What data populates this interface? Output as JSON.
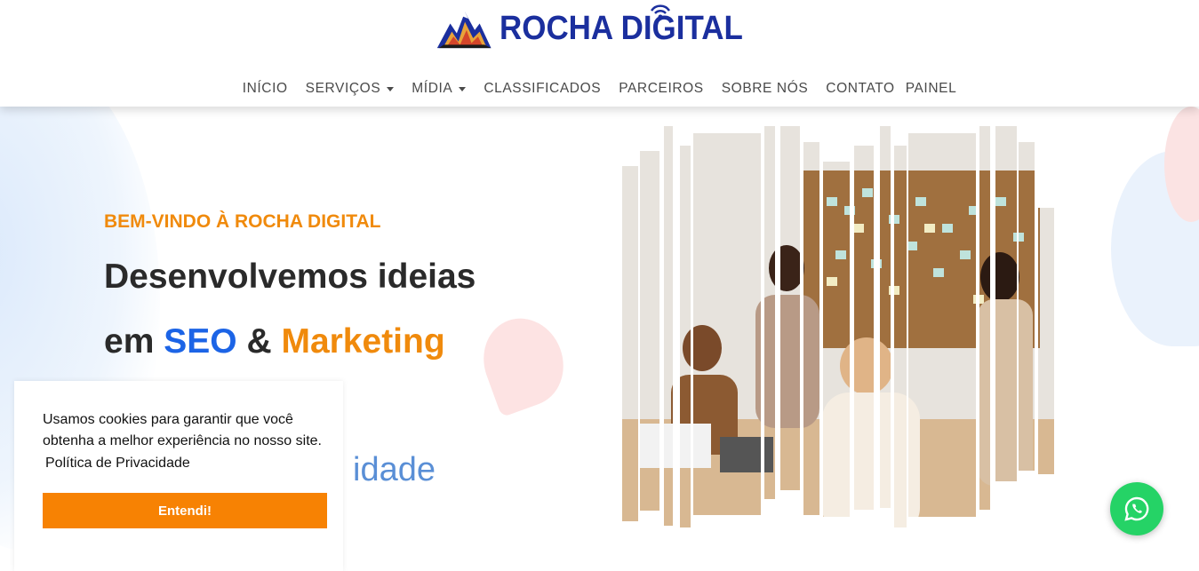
{
  "brand": {
    "name": "ROCHA DIGITAL",
    "color": "#1b2f9e"
  },
  "nav": {
    "items": [
      {
        "label": "INÍCIO",
        "dropdown": false
      },
      {
        "label": "SERVIÇOS",
        "dropdown": true
      },
      {
        "label": "MÍDIA",
        "dropdown": true
      },
      {
        "label": "CLASSIFICADOS",
        "dropdown": false
      },
      {
        "label": "PARCEIROS",
        "dropdown": false
      },
      {
        "label": "SOBRE NÓS",
        "dropdown": false
      },
      {
        "label": "CONTATO",
        "dropdown": false
      },
      {
        "label": "PAINEL",
        "dropdown": false
      }
    ]
  },
  "hero": {
    "eyebrow": "BEM-VINDO À ROCHA DIGITAL",
    "line1": "Desenvolvemos ideias",
    "line2_prefix": "em",
    "line2_seo": "SEO",
    "line2_amp": "&",
    "line2_marketing": "Marketing",
    "partial_word": "idade",
    "colors": {
      "orange": "#f08a0c",
      "blue": "#1c64e6"
    }
  },
  "cookie": {
    "text": "Usamos cookies para garantir que você obtenha a melhor experiência no nosso site.",
    "link": "Política de Privacidade",
    "button": "Entendi!",
    "button_color": "#f78203"
  },
  "whatsapp": {
    "icon": "whatsapp-icon",
    "color": "#25d366"
  }
}
